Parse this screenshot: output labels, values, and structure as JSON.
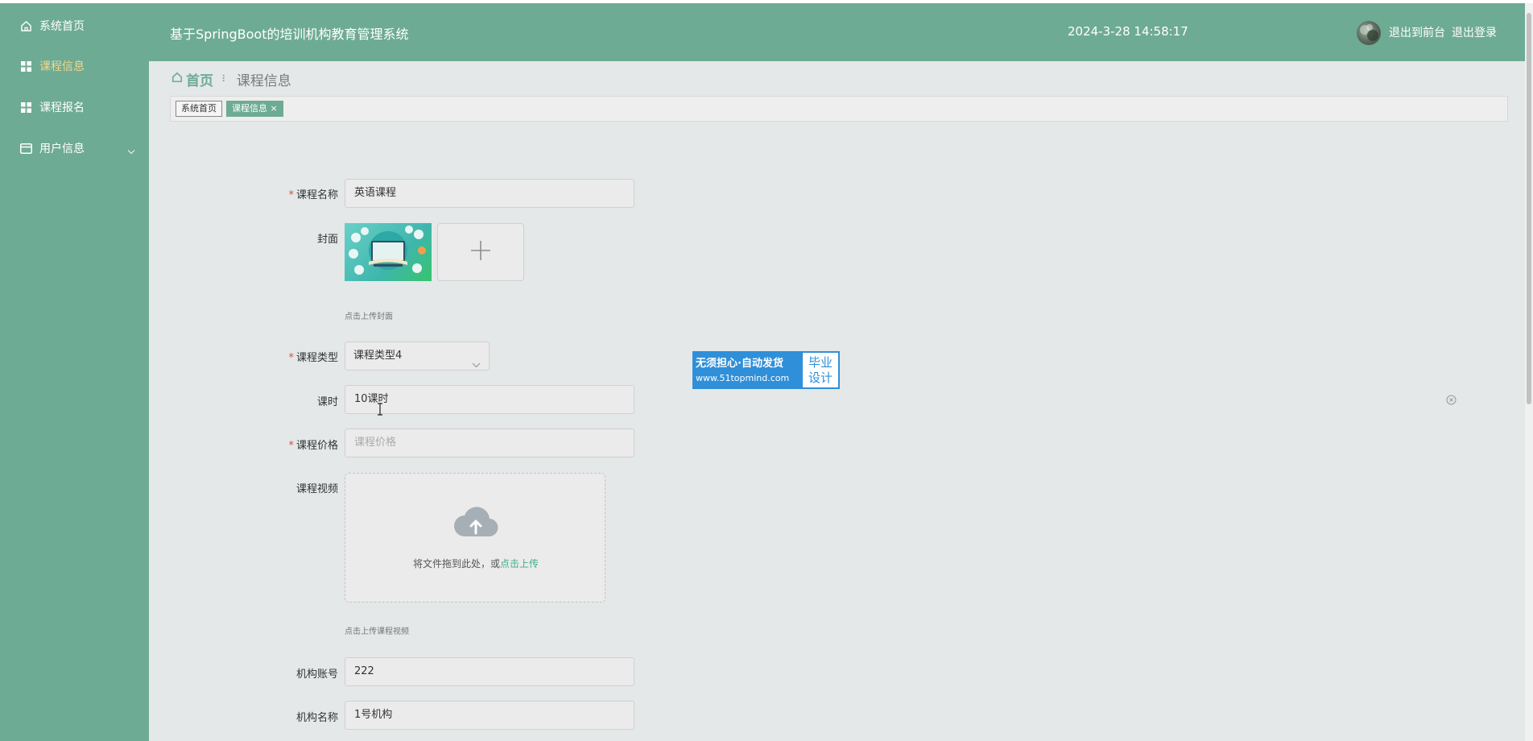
{
  "header": {
    "title": "基于SpringBoot的培训机构教育管理系统",
    "datetime": "2024-3-28 14:58:17",
    "link_front": "退出到前台",
    "link_logout": "退出登录"
  },
  "sidebar": {
    "items": [
      {
        "label": "系统首页",
        "icon": "home-icon"
      },
      {
        "label": "课程信息",
        "icon": "grid-icon",
        "active": true
      },
      {
        "label": "课程报名",
        "icon": "grid-icon"
      },
      {
        "label": "用户信息",
        "icon": "card-icon",
        "expandable": true
      }
    ]
  },
  "breadcrumb": {
    "home": "首页",
    "separator": "⠇",
    "current": "课程信息"
  },
  "tags": [
    {
      "label": "系统首页"
    },
    {
      "label": "课程信息 ×",
      "active": true
    }
  ],
  "form": {
    "course_name": {
      "label": "课程名称",
      "value": "英语课程",
      "required": true
    },
    "cover": {
      "label": "封面",
      "tip": "点击上传封面"
    },
    "course_type": {
      "label": "课程类型",
      "value": "课程类型4",
      "required": true
    },
    "hours": {
      "label": "课时",
      "value": "10课时"
    },
    "price": {
      "label": "课程价格",
      "placeholder": "课程价格",
      "required": true
    },
    "video": {
      "label": "课程视频",
      "drop_text": "将文件拖到此处，或",
      "drop_link": "点击上传",
      "tip": "点击上传课程视频"
    },
    "org_account": {
      "label": "机构账号",
      "value": "222"
    },
    "org_name": {
      "label": "机构名称",
      "value": "1号机构"
    }
  },
  "watermark": {
    "line1": "无须担心·自动发货",
    "line2": "www.51topmind.com",
    "right1": "毕业",
    "right2": "设计"
  },
  "colors": {
    "theme": "#6eab94",
    "active_menu": "#f1d78f",
    "required": "#e04b4b",
    "link": "#3fae8a"
  }
}
